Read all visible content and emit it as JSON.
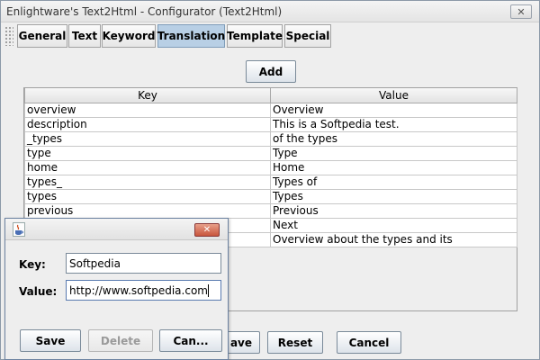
{
  "window": {
    "title": "Enlightware's Text2Html - Configurator (Text2Html)",
    "close_label": "✕"
  },
  "tabs": [
    {
      "label": "General",
      "active": false
    },
    {
      "label": "Text",
      "active": false
    },
    {
      "label": "Keyword",
      "active": false
    },
    {
      "label": "Translation",
      "active": true
    },
    {
      "label": "Template",
      "active": false
    },
    {
      "label": "Special",
      "active": false
    }
  ],
  "toolbar": {
    "add_label": "Add"
  },
  "table": {
    "headers": [
      "Key",
      "Value"
    ],
    "rows": [
      [
        "overview",
        "Overview"
      ],
      [
        "description",
        "This is a Softpedia test."
      ],
      [
        "_types",
        "of the types"
      ],
      [
        "type",
        "Type"
      ],
      [
        "home",
        "Home"
      ],
      [
        "types_",
        "Types of"
      ],
      [
        "types",
        "Types"
      ],
      [
        "previous",
        "Previous"
      ],
      [
        "",
        "Next"
      ],
      [
        "",
        "Overview about the types and its"
      ]
    ]
  },
  "footer": {
    "save_partial": "ave",
    "reset_label": "Reset",
    "cancel_label": "Cancel"
  },
  "dialog": {
    "key_label": "Key:",
    "key_value": "Softpedia",
    "value_label": "Value:",
    "value_value": "http://www.softpedia.com",
    "save_label": "Save",
    "delete_label": "Delete",
    "cancel_label": "Can...",
    "close_label": "✕"
  },
  "colors": {
    "active_tab": "#b8cfe5",
    "dialog_close": "#c8553c"
  },
  "icons": {
    "app": "java-cup-icon",
    "close": "close-icon"
  }
}
